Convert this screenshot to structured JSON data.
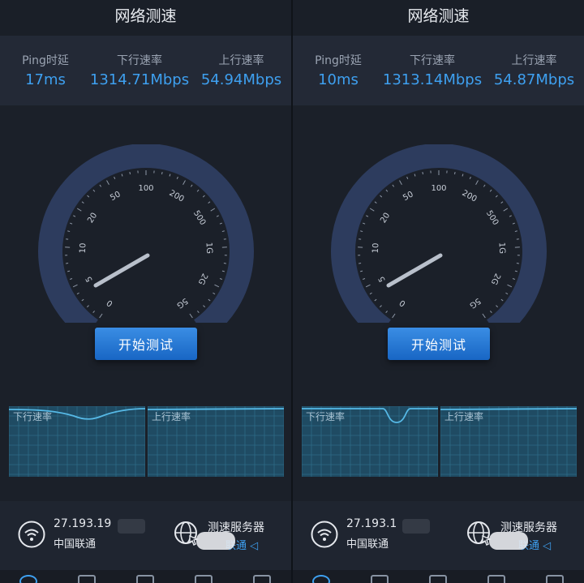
{
  "screens": [
    {
      "title": "网络测速",
      "ping_label": "Ping时延",
      "ping_value": "17ms",
      "down_label": "下行速率",
      "down_value": "1314.71Mbps",
      "up_label": "上行速率",
      "up_value": "54.94Mbps",
      "gauge_ticks": [
        "0",
        "5",
        "10",
        "20",
        "50",
        "100",
        "200",
        "500",
        "1G",
        "2G",
        "5G"
      ],
      "start_button": "开始测试",
      "dl_graph_label": "下行速率",
      "ul_graph_label": "上行速率",
      "ip": "27.193.19",
      "isp": "中国联通",
      "server_title": "测速服务器",
      "server_sub": "联通 ◁"
    },
    {
      "title": "网络测速",
      "ping_label": "Ping时延",
      "ping_value": "10ms",
      "down_label": "下行速率",
      "down_value": "1313.14Mbps",
      "up_label": "上行速率",
      "up_value": "54.87Mbps",
      "gauge_ticks": [
        "0",
        "5",
        "10",
        "20",
        "50",
        "100",
        "200",
        "500",
        "1G",
        "2G",
        "5G"
      ],
      "start_button": "开始测试",
      "dl_graph_label": "下行速率",
      "ul_graph_label": "上行速率",
      "ip": "27.193.1",
      "isp": "中国联通",
      "server_title": "测速服务器",
      "server_sub": "联通 ◁"
    }
  ],
  "colors": {
    "accent": "#3ea0f0",
    "background": "#1b2029",
    "panel": "#232936",
    "gauge_arc": "#2d3c5e",
    "graph_fill": "#1f4b63"
  },
  "icons": [
    "wifi-icon",
    "globe-cursor-icon",
    "speed-nav-icon",
    "trend-nav-icon",
    "list-nav-icon",
    "box-nav-icon",
    "shield-nav-icon"
  ]
}
